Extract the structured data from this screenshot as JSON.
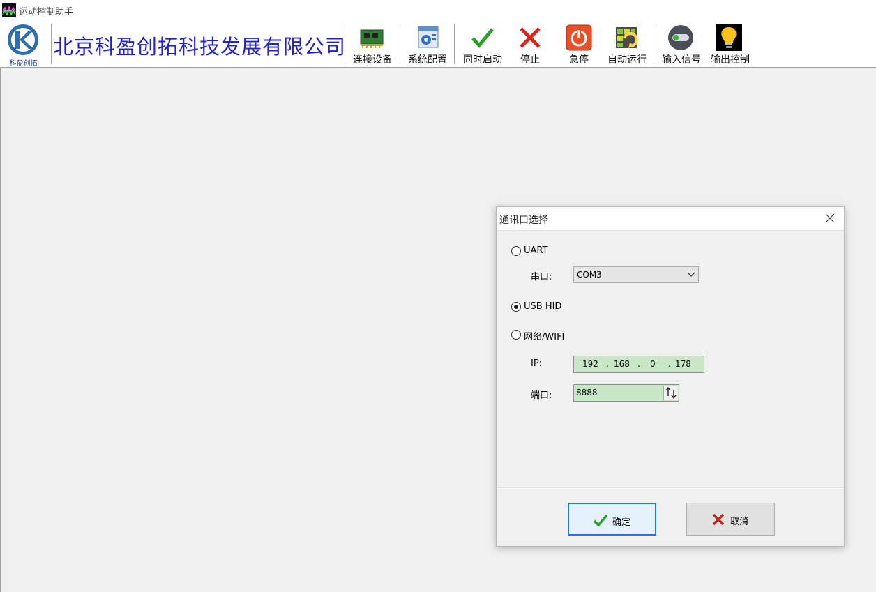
{
  "window": {
    "title": "运动控制助手"
  },
  "toolbar": {
    "logo_text": "科盈创拓",
    "company_name": "北京科盈创拓科技发展有限公司",
    "buttons": [
      {
        "label": "连接设备",
        "icon": "circuit-board-icon"
      },
      {
        "label": "系统配置",
        "icon": "system-config-icon"
      },
      {
        "label": "同时启动",
        "icon": "check-icon"
      },
      {
        "label": "停止",
        "icon": "red-x-icon"
      },
      {
        "label": "急停",
        "icon": "power-icon"
      },
      {
        "label": "自动运行",
        "icon": "auto-run-icon"
      },
      {
        "label": "输入信号",
        "icon": "toggle-switch-icon"
      },
      {
        "label": "输出控制",
        "icon": "lightbulb-icon"
      }
    ]
  },
  "dialog": {
    "title": "通讯口选择",
    "options": {
      "uart": {
        "label": "UART",
        "checked": false
      },
      "usb_hid": {
        "label": "USB HID",
        "checked": true
      },
      "network": {
        "label": "网络/WIFI",
        "checked": false
      }
    },
    "serial_label": "串口:",
    "serial_value": "COM3",
    "ip_label": "IP:",
    "ip": [
      "192",
      "168",
      "0",
      "178"
    ],
    "ip_dot": ".",
    "port_label": "端口:",
    "port_value": "8888",
    "ok_label": "确定",
    "cancel_label": "取消"
  },
  "colors": {
    "company_text": "#1f1fd6",
    "field_bg": "#c7e7c7",
    "primary_border": "#1e7ad6",
    "stop_red": "#e0241b",
    "check_green": "#2aa02a"
  }
}
